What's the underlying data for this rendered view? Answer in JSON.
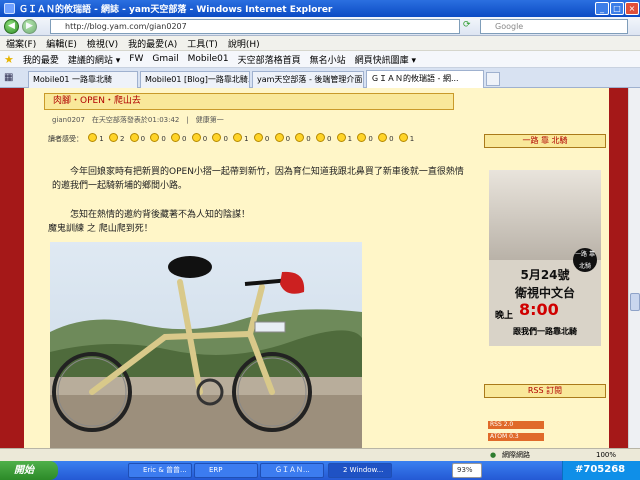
{
  "window": {
    "title": "ＧＩＡＮ的攸瑞語 - 網誌 - yam天空部落 - Windows Internet Explorer"
  },
  "address": {
    "url": "http://blog.yam.com/gian0207",
    "search_placeholder": "Google"
  },
  "menu": [
    "檔案(F)",
    "編輯(E)",
    "檢視(V)",
    "我的最愛(A)",
    "工具(T)",
    "說明(H)"
  ],
  "favorites": {
    "label": "我的最愛",
    "items": [
      "建議的網站 ▾",
      "FW",
      "Gmail",
      "Mobile01",
      "天空部落格首頁",
      "無名小站",
      "網頁快訊圖庫 ▾"
    ]
  },
  "tabs": [
    "Mobile01 一路靠北騎",
    "Mobile01 [Blog]一路靠北騎...",
    "yam天空部落 - 後端管理介面",
    "ＧＩＡＮ的攸瑞語 - 網..."
  ],
  "post": {
    "title": "肉腳・OPEN・爬山去",
    "meta": "gian0207　在天空部落發表於01:03:42　|　健康第一",
    "mood_label": "讀者感受：",
    "mood_counts": [
      "1",
      "2",
      "0",
      "0",
      "0",
      "0",
      "0",
      "1",
      "0",
      "0",
      "0",
      "0",
      "1",
      "0",
      "0",
      "1"
    ],
    "para1": "今年回娘家時有把新買的OPEN小摺一起帶到新竹，因為育仁知道我跟北鼻買了新車後就一直很熱情的邀我們一起騎新埔的鄉間小路。",
    "para2": "怎知在熱情的邀約背後藏著不為人知的陰謀！",
    "para3": "魔鬼訓練 之 爬山爬到死！"
  },
  "sidebar": {
    "section1": "一路 靠 北騎",
    "ad": {
      "date_num": "5月24號",
      "channel": "衛視中文台",
      "time_prefix": "晚上",
      "time": "8:00",
      "slogan": "跟我們一路靠北騎",
      "logo": "一路 靠北騎"
    },
    "section2": "RSS 訂閱",
    "rss": [
      "RSS 2.0",
      "ATOM 0.3"
    ]
  },
  "status": {
    "zone": "網際網路",
    "zoom": "100%"
  },
  "taskbar": {
    "start": "開始",
    "tasks": [
      "Eric & 曾曾...",
      "ERP",
      "ＧＩＡＮ...",
      "2 Window...",
      "93%"
    ],
    "tray_text": "#705268"
  },
  "colors": {
    "brand_red": "#a51818",
    "page_bg": "#fff6c8",
    "title_bg": "#f9e89a"
  }
}
